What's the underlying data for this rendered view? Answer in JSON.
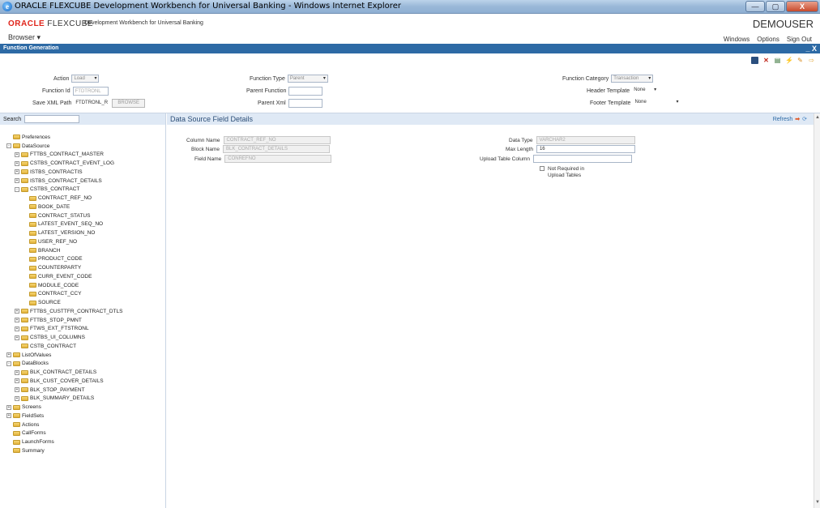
{
  "window": {
    "title": "ORACLE FLEXCUBE Development Workbench for Universal Banking - Windows Internet Explorer",
    "minimize": "—",
    "restore": "▢",
    "close": "X"
  },
  "header": {
    "logo_oracle": "ORACLE",
    "logo_flexcube": "FLEXCUBE",
    "subtitle": "Development Workbench for Universal Banking",
    "user": "DEMOUSER",
    "browser_menu": "Browser",
    "menu": [
      "Windows",
      "Options",
      "Sign Out"
    ]
  },
  "function_bar": {
    "title": "Function Generation",
    "controls": "_ X"
  },
  "toolbar": {
    "icons": [
      "save-icon",
      "delete-icon",
      "list-icon",
      "generate-icon",
      "deploy-icon",
      "exit-icon"
    ]
  },
  "form": {
    "action_label": "Action",
    "action_value": "Load",
    "function_id_label": "Function Id",
    "function_id_value": "FTDTRONL",
    "save_xml_label": "Save XML Path",
    "save_xml_value": "FTDTRONL_R",
    "browse_label": "BROWSE",
    "function_type_label": "Function Type",
    "function_type_value": "Parent",
    "parent_function_label": "Parent Function",
    "parent_xml_label": "Parent Xml",
    "function_category_label": "Function Category",
    "function_category_value": "Transaction",
    "header_template_label": "Header Template",
    "header_template_value": "None",
    "footer_template_label": "Footer Template",
    "footer_template_value": "None"
  },
  "left": {
    "search_label": "Search",
    "tree": [
      {
        "label": "Preferences",
        "level": 0,
        "exp": ""
      },
      {
        "label": "DataSource",
        "level": 0,
        "exp": "-"
      },
      {
        "label": "FTTBS_CONTRACT_MASTER",
        "level": 1,
        "exp": "+"
      },
      {
        "label": "CSTBS_CONTRACT_EVENT_LOG",
        "level": 1,
        "exp": "+"
      },
      {
        "label": "ISTBS_CONTRACTIS",
        "level": 1,
        "exp": "+"
      },
      {
        "label": "ISTBS_CONTRACT_DETAILS",
        "level": 1,
        "exp": "+"
      },
      {
        "label": "CSTBS_CONTRACT",
        "level": 1,
        "exp": "-"
      },
      {
        "label": "CONTRACT_REF_NO",
        "level": 2,
        "exp": ""
      },
      {
        "label": "BOOK_DATE",
        "level": 2,
        "exp": ""
      },
      {
        "label": "CONTRACT_STATUS",
        "level": 2,
        "exp": ""
      },
      {
        "label": "LATEST_EVENT_SEQ_NO",
        "level": 2,
        "exp": ""
      },
      {
        "label": "LATEST_VERSION_NO",
        "level": 2,
        "exp": ""
      },
      {
        "label": "USER_REF_NO",
        "level": 2,
        "exp": ""
      },
      {
        "label": "BRANCH",
        "level": 2,
        "exp": ""
      },
      {
        "label": "PRODUCT_CODE",
        "level": 2,
        "exp": ""
      },
      {
        "label": "COUNTERPARTY",
        "level": 2,
        "exp": ""
      },
      {
        "label": "CURR_EVENT_CODE",
        "level": 2,
        "exp": ""
      },
      {
        "label": "MODULE_CODE",
        "level": 2,
        "exp": ""
      },
      {
        "label": "CONTRACT_CCY",
        "level": 2,
        "exp": ""
      },
      {
        "label": "SOURCE",
        "level": 2,
        "exp": ""
      },
      {
        "label": "FTTBS_CUSTTFR_CONTRACT_DTLS",
        "level": 1,
        "exp": "+"
      },
      {
        "label": "FTTBS_STOP_PMNT",
        "level": 1,
        "exp": "+"
      },
      {
        "label": "FTWS_EXT_FTSTRONL",
        "level": 1,
        "exp": "+"
      },
      {
        "label": "CSTBS_UI_COLUMNS",
        "level": 1,
        "exp": "+"
      },
      {
        "label": "CSTB_CONTRACT",
        "level": 1,
        "exp": ""
      },
      {
        "label": "ListOfValues",
        "level": 0,
        "exp": "+"
      },
      {
        "label": "DataBlocks",
        "level": 0,
        "exp": "-"
      },
      {
        "label": "BLK_CONTRACT_DETAILS",
        "level": 1,
        "exp": "+"
      },
      {
        "label": "BLK_CUST_COVER_DETAILS",
        "level": 1,
        "exp": "+"
      },
      {
        "label": "BLK_STOP_PAYMENT",
        "level": 1,
        "exp": "+"
      },
      {
        "label": "BLK_SUMMARY_DETAILS",
        "level": 1,
        "exp": "+"
      },
      {
        "label": "Screens",
        "level": 0,
        "exp": "+"
      },
      {
        "label": "FieldSets",
        "level": 0,
        "exp": "+"
      },
      {
        "label": "Actions",
        "level": 0,
        "exp": ""
      },
      {
        "label": "CallForms",
        "level": 0,
        "exp": ""
      },
      {
        "label": "LaunchForms",
        "level": 0,
        "exp": ""
      },
      {
        "label": "Summary",
        "level": 0,
        "exp": ""
      }
    ]
  },
  "details": {
    "title": "Data Source Field Details",
    "refresh_label": "Refresh",
    "column_name_label": "Column Name",
    "column_name_value": "CONTRACT_REF_NO",
    "block_name_label": "Block Name",
    "block_name_value": "BLK_CONTRACT_DETAILS",
    "field_name_label": "Field Name",
    "field_name_value": "CONREFNO",
    "data_type_label": "Data Type",
    "data_type_value": "VARCHAR2",
    "max_length_label": "Max Length",
    "max_length_value": "16",
    "upload_table_column_label": "Upload Table Column",
    "not_required_label_1": "Not Required in",
    "not_required_label_2": "Upload Tables"
  }
}
